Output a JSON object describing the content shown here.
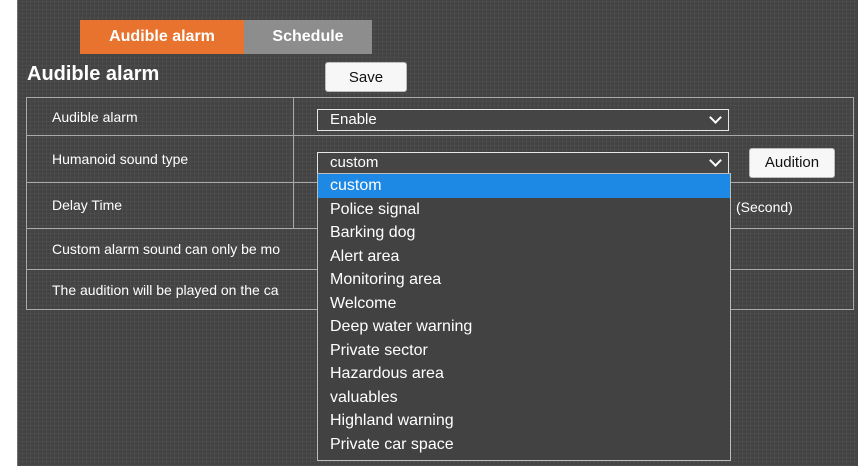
{
  "tabs": {
    "audible": "Audible alarm",
    "schedule": "Schedule"
  },
  "header": {
    "title": "Audible alarm",
    "save_label": "Save"
  },
  "form": {
    "audible_alarm": {
      "label": "Audible alarm",
      "value": "Enable"
    },
    "sound_type": {
      "label": "Humanoid sound type",
      "value": "custom",
      "audition_label": "Audition"
    },
    "delay": {
      "label": "Delay Time",
      "unit": "(Second)"
    },
    "note1": "Custom alarm sound can only be mo",
    "note2": "The audition will be played on the ca"
  },
  "dropdown": {
    "selected_index": 0,
    "options": [
      "custom",
      "Police signal",
      "Barking dog",
      "Alert area",
      "Monitoring area",
      "Welcome",
      "Deep water warning",
      "Private sector",
      "Hazardous area",
      "valuables",
      "Highland warning",
      "Private car space"
    ]
  },
  "colors": {
    "active_tab": "#e8732f",
    "inactive_tab": "#8d8d8d",
    "panel_bg": "#434343",
    "highlight": "#1e88e5"
  }
}
